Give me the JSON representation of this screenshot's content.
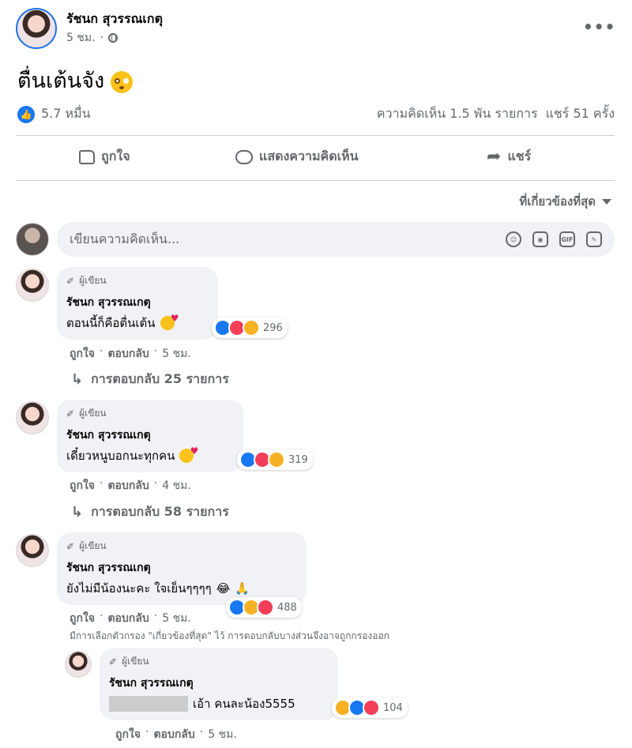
{
  "post": {
    "author": "รัชนก สุวรรณเกตุ",
    "time": "5 ชม.",
    "text": "ตื่นเต้นจัง",
    "likes": "5.7 หมื่น",
    "comments_count": "ความคิดเห็น 1.5 พัน รายการ",
    "shares_count": "แชร์ 51 ครั้ง"
  },
  "actions": {
    "like": "ถูกใจ",
    "comment": "แสดงความคิดเห็น",
    "share": "แชร์"
  },
  "sort": {
    "label": "ที่เกี่ยวข้องที่สุด"
  },
  "composer": {
    "placeholder": "เขียนความคิดเห็น...",
    "gif": "GIF"
  },
  "comments": [
    {
      "badge": "ผู้เขียน",
      "name": "รัชนก สุวรรณเกตุ",
      "text": "ตอนนี้ก็คือตื่นเต้น",
      "reactions": "296",
      "like": "ถูกใจ",
      "reply": "ตอบกลับ",
      "time": "5 ชม.",
      "replies": "การตอบกลับ 25 รายการ"
    },
    {
      "badge": "ผู้เขียน",
      "name": "รัชนก สุวรรณเกตุ",
      "text": "เดี๋ยวหนูบอกนะทุกคน",
      "reactions": "319",
      "like": "ถูกใจ",
      "reply": "ตอบกลับ",
      "time": "4 ชม.",
      "replies": "การตอบกลับ 58 รายการ"
    },
    {
      "badge": "ผู้เขียน",
      "name": "รัชนก สุวรรณเกตุ",
      "text": "ยังไม่มีน้องนะคะ ใจเย็นๆๆๆๆ",
      "reactions": "488",
      "like": "ถูกใจ",
      "reply": "ตอบกลับ",
      "time": "5 ชม."
    }
  ],
  "filter_note": "มีการเลือกตัวกรอง \"เกี่ยวข้องที่สุด\" ไว้ การตอบกลับบางส่วนจึงอาจถูกกรองออก",
  "reply": {
    "badge": "ผู้เขียน",
    "name": "รัชนก สุวรรณเกตุ",
    "text": "เอ้า คนละน้อง5555",
    "reactions": "104",
    "like": "ถูกใจ",
    "reply": "ตอบกลับ",
    "time": "5 ชม."
  }
}
